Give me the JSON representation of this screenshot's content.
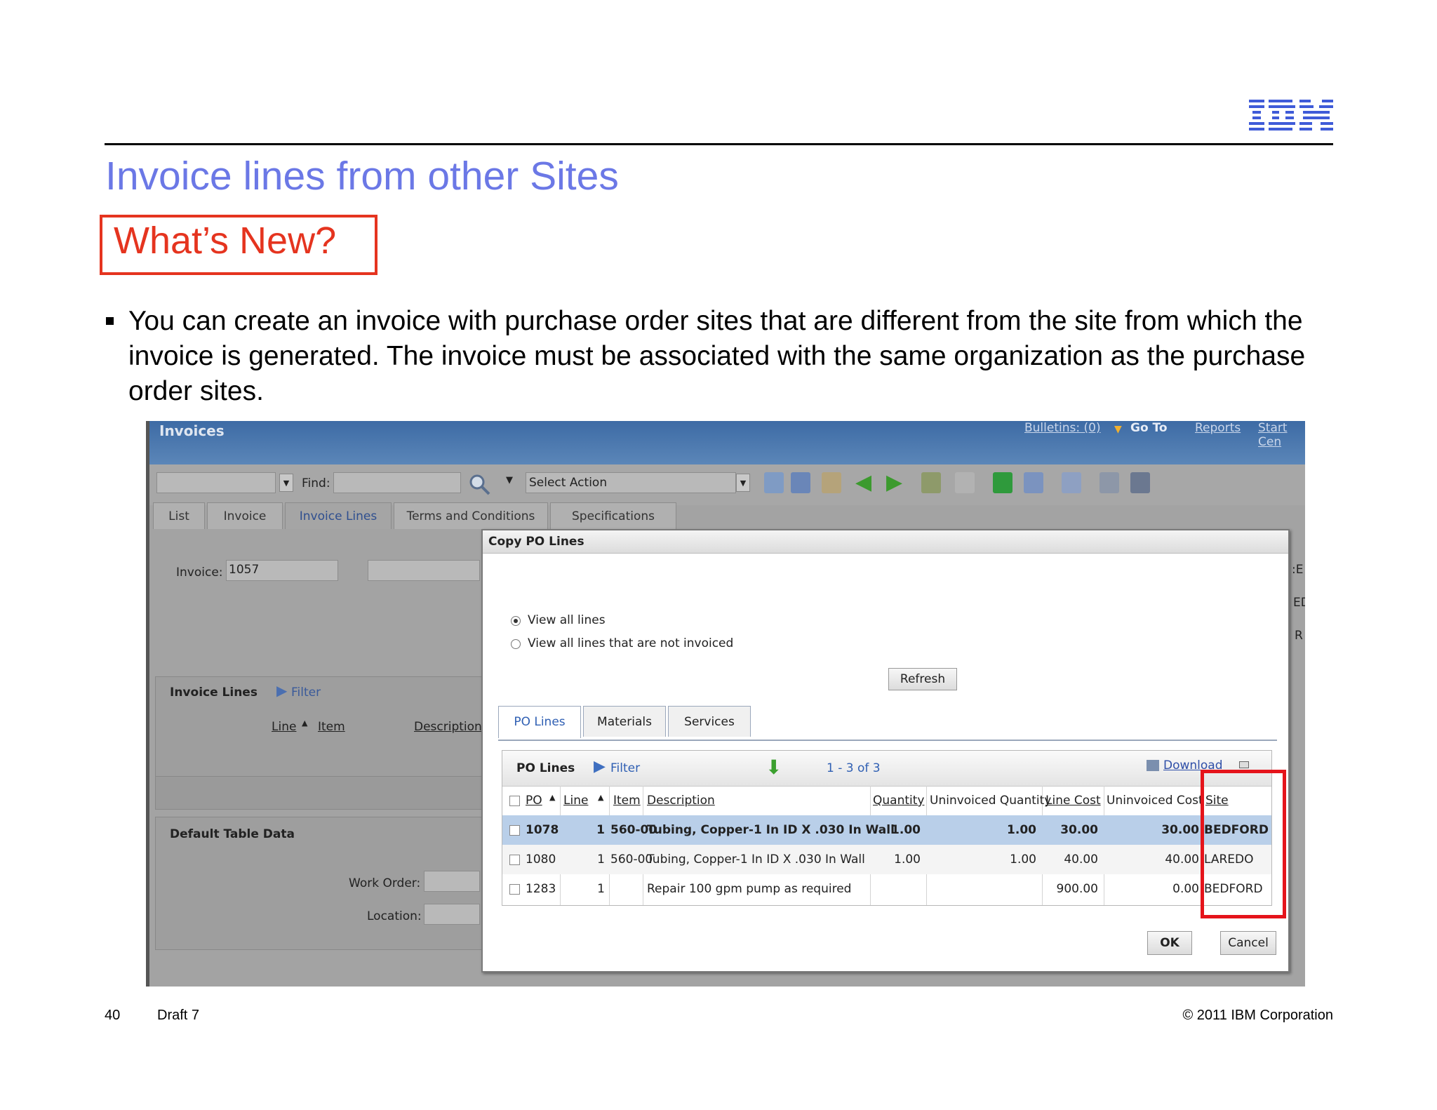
{
  "slide": {
    "logo_text": "IBM",
    "title": "Invoice lines from other Sites",
    "whats_new": "What’s New?",
    "bullet": "You can create an invoice with purchase order sites that are different from the site from which the invoice is generated. The invoice must be associated with the same organization as the purchase order sites.",
    "page_number": "40",
    "draft": "Draft 7",
    "copyright": "© 2011 IBM Corporation"
  },
  "app": {
    "title": "Invoices",
    "header_links": {
      "bulletins": "Bulletins: (0)",
      "goto": "Go To",
      "reports": "Reports",
      "start_center": "Start Cen"
    },
    "toolbar": {
      "find_label": "Find:",
      "select_action": "Select Action"
    },
    "tabs": [
      "List",
      "Invoice",
      "Invoice Lines",
      "Terms and Conditions",
      "Specifications"
    ],
    "active_tab": "Invoice Lines",
    "form": {
      "invoice_label": "Invoice:",
      "invoice_value": "1057",
      "invoice_lines_title": "Invoice Lines",
      "filter_label": "Filter",
      "columns": [
        "Line",
        "Item",
        "Description"
      ],
      "default_table_title": "Default Table Data",
      "work_order_label": "Work Order:",
      "location_label": "Location:",
      "right_clip": [
        ":E",
        "ED",
        "R"
      ]
    }
  },
  "dialog": {
    "title": "Copy PO Lines",
    "radio_all": "View all lines",
    "radio_not_invoiced": "View all lines that are not invoiced",
    "refresh": "Refresh",
    "tabs": [
      "PO Lines",
      "Materials",
      "Services"
    ],
    "grid": {
      "title": "PO Lines",
      "filter": "Filter",
      "paging": "1 - 3 of 3",
      "download": "Download",
      "headers": [
        "PO",
        "Line",
        "Item",
        "Description",
        "Quantity",
        "Uninvoiced Quantity",
        "Line Cost",
        "Uninvoiced Cost",
        "Site"
      ],
      "rows": [
        {
          "po": "1078",
          "line": "1",
          "item": "560-00",
          "description": "Tubing, Copper-1 In ID X .030 In Wall",
          "quantity": "1.00",
          "uninvoiced_quantity": "1.00",
          "line_cost": "30.00",
          "uninvoiced_cost": "30.00",
          "site": "BEDFORD"
        },
        {
          "po": "1080",
          "line": "1",
          "item": "560-00",
          "description": "Tubing, Copper-1 In ID X .030 In Wall",
          "quantity": "1.00",
          "uninvoiced_quantity": "1.00",
          "line_cost": "40.00",
          "uninvoiced_cost": "40.00",
          "site": "LAREDO"
        },
        {
          "po": "1283",
          "line": "1",
          "item": "",
          "description": "Repair 100 gpm pump as required",
          "quantity": "",
          "uninvoiced_quantity": "",
          "line_cost": "900.00",
          "uninvoiced_cost": "0.00",
          "site": "BEDFORD"
        }
      ]
    },
    "ok": "OK",
    "cancel": "Cancel"
  },
  "colors": {
    "title": "#6b78e6",
    "highlight": "#e5341f",
    "callout": "#e5141b",
    "ibm_logo": "#3f5bd8"
  }
}
